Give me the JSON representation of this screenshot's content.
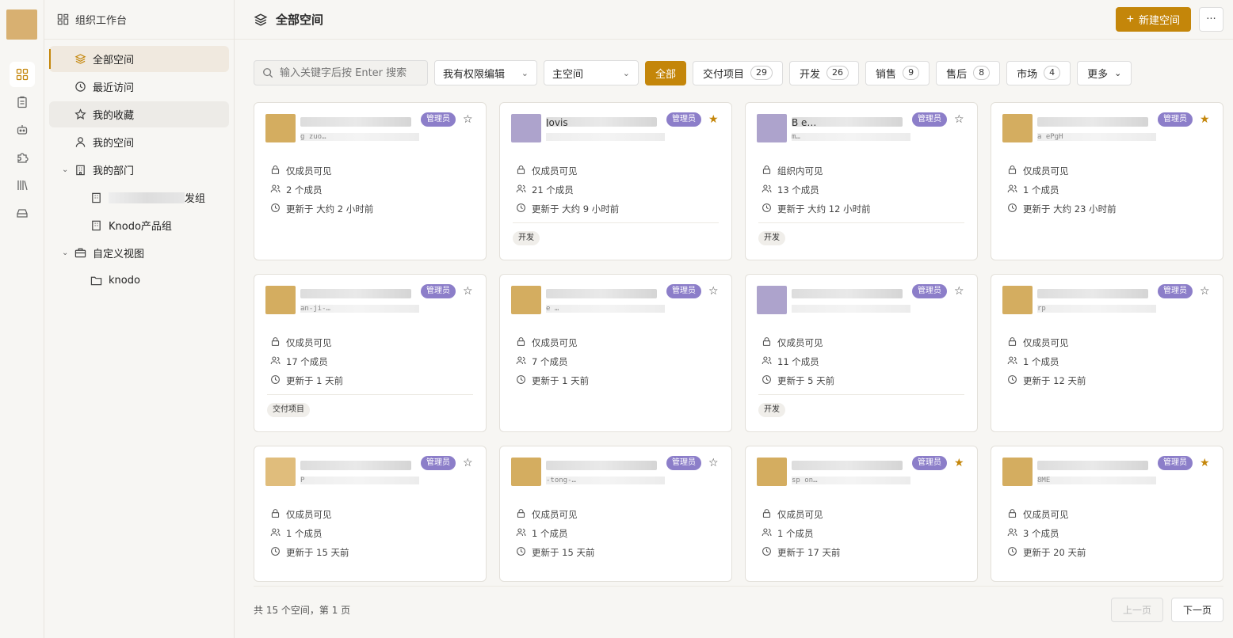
{
  "sidebar": {
    "header": "组织工作台",
    "items": [
      {
        "label": "全部空间"
      },
      {
        "label": "最近访问"
      },
      {
        "label": "我的收藏"
      },
      {
        "label": "我的空间"
      },
      {
        "label": "我的部门"
      },
      {
        "label": "发组"
      },
      {
        "label": "Knodo产品组"
      },
      {
        "label": "自定义视图"
      },
      {
        "label": "knodo"
      }
    ]
  },
  "header": {
    "title": "全部空间",
    "new_label": "新建空间",
    "more_label": "···"
  },
  "filters": {
    "search_placeholder": "输入关键字后按 Enter 搜索",
    "perm_select": "我有权限编辑",
    "space_select": "主空间",
    "chips": [
      {
        "label": "全部"
      },
      {
        "label": "交付项目",
        "count": "29"
      },
      {
        "label": "开发",
        "count": "26"
      },
      {
        "label": "销售",
        "count": "9"
      },
      {
        "label": "售后",
        "count": "8"
      },
      {
        "label": "市场",
        "count": "4"
      },
      {
        "label": "更多"
      }
    ]
  },
  "cards": [
    {
      "name": "",
      "slug": "g zuo…",
      "badge": "管理员",
      "starred": false,
      "visibility": "仅成员可见",
      "members": "2 个成员",
      "updated": "更新于 大约 2 小时前",
      "tag": "",
      "avatar_color": "#d4ad60"
    },
    {
      "name": "Jovis",
      "slug": "",
      "badge": "管理员",
      "starred": true,
      "visibility": "仅成员可见",
      "members": "21 个成员",
      "updated": "更新于 大约 9 小时前",
      "tag": "开发",
      "avatar_color": "#ada3cc"
    },
    {
      "name": "B e…",
      "slug": "m…",
      "badge": "管理员",
      "starred": false,
      "visibility": "组织内可见",
      "members": "13 个成员",
      "updated": "更新于 大约 12 小时前",
      "tag": "开发",
      "avatar_color": "#ada3cc"
    },
    {
      "name": "",
      "slug": "a ePgH",
      "badge": "管理员",
      "starred": true,
      "visibility": "仅成员可见",
      "members": "1 个成员",
      "updated": "更新于 大约 23 小时前",
      "tag": "",
      "avatar_color": "#d4ad60"
    },
    {
      "name": "",
      "slug": "an-ji-…",
      "badge": "管理员",
      "starred": false,
      "visibility": "仅成员可见",
      "members": "17 个成员",
      "updated": "更新于 1 天前",
      "tag": "交付项目",
      "avatar_color": "#d4ad60"
    },
    {
      "name": "",
      "slug": "e …",
      "badge": "管理员",
      "starred": false,
      "visibility": "仅成员可见",
      "members": "7 个成员",
      "updated": "更新于 1 天前",
      "tag": "",
      "avatar_color": "#d4ad60"
    },
    {
      "name": "",
      "slug": "",
      "badge": "管理员",
      "starred": false,
      "visibility": "仅成员可见",
      "members": "11 个成员",
      "updated": "更新于 5 天前",
      "tag": "开发",
      "avatar_color": "#ada3cc"
    },
    {
      "name": "",
      "slug": "rp",
      "badge": "管理员",
      "starred": false,
      "visibility": "仅成员可见",
      "members": "1 个成员",
      "updated": "更新于 12 天前",
      "tag": "",
      "avatar_color": "#d4ad60"
    },
    {
      "name": "",
      "slug": "P",
      "badge": "管理员",
      "starred": false,
      "visibility": "仅成员可见",
      "members": "1 个成员",
      "updated": "更新于 15 天前",
      "tag": "",
      "avatar_color": "#e0bd7c"
    },
    {
      "name": "",
      "slug": "-tong-…",
      "badge": "管理员",
      "starred": false,
      "visibility": "仅成员可见",
      "members": "1 个成员",
      "updated": "更新于 15 天前",
      "tag": "",
      "avatar_color": "#d4ad60"
    },
    {
      "name": "",
      "slug": "sp on…",
      "badge": "管理员",
      "starred": true,
      "visibility": "仅成员可见",
      "members": "1 个成员",
      "updated": "更新于 17 天前",
      "tag": "",
      "avatar_color": "#d4ad60"
    },
    {
      "name": "",
      "slug": "8ME",
      "badge": "管理员",
      "starred": true,
      "visibility": "仅成员可见",
      "members": "3 个成员",
      "updated": "更新于 20 天前",
      "tag": "",
      "avatar_color": "#d4ad60"
    }
  ],
  "footer": {
    "info": "共 15 个空间，第 1 页",
    "prev": "上一页",
    "next": "下一页"
  },
  "colors": {
    "accent": "#c4860a",
    "badge": "#8c7ec9"
  }
}
